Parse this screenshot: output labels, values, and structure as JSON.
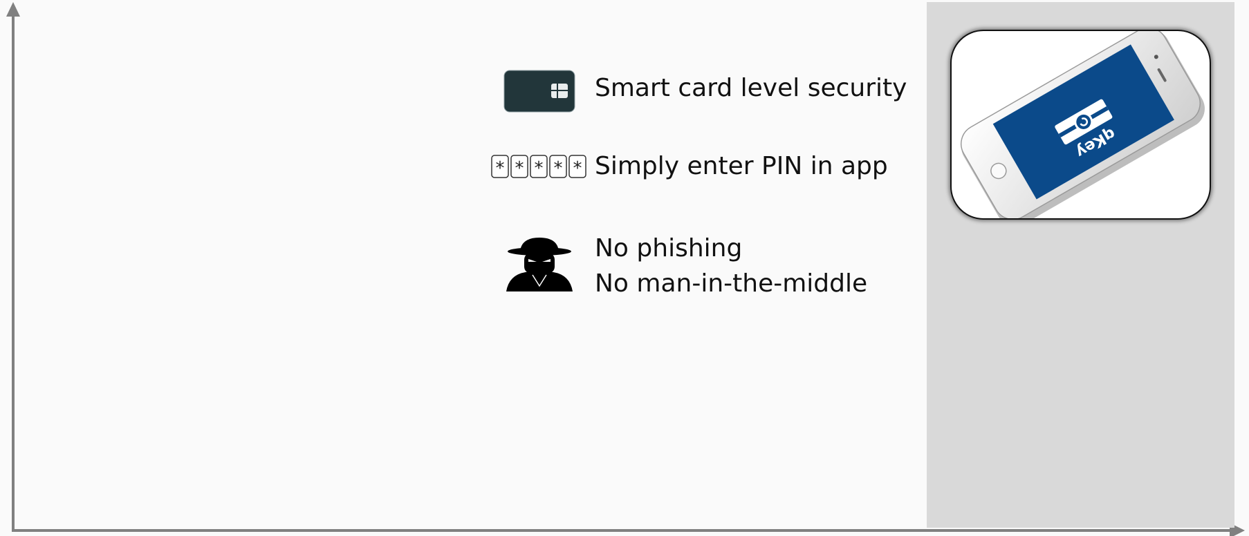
{
  "features": [
    {
      "icon": "smart-card-icon",
      "lines": [
        "Smart card level security"
      ]
    },
    {
      "icon": "pin-keypad-icon",
      "lines": [
        "Simply enter PIN in app"
      ]
    },
    {
      "icon": "hacker-spy-icon",
      "lines": [
        "No phishing",
        "No man-in-the-middle"
      ]
    }
  ],
  "phone": {
    "icon": "smartphone-icon",
    "app_label": "qKey",
    "screen_color": "#0b4a8a"
  },
  "colors": {
    "background": "#fafafa",
    "panel": "#d9d9d9",
    "axis": "#808080",
    "card": "#22363a"
  }
}
